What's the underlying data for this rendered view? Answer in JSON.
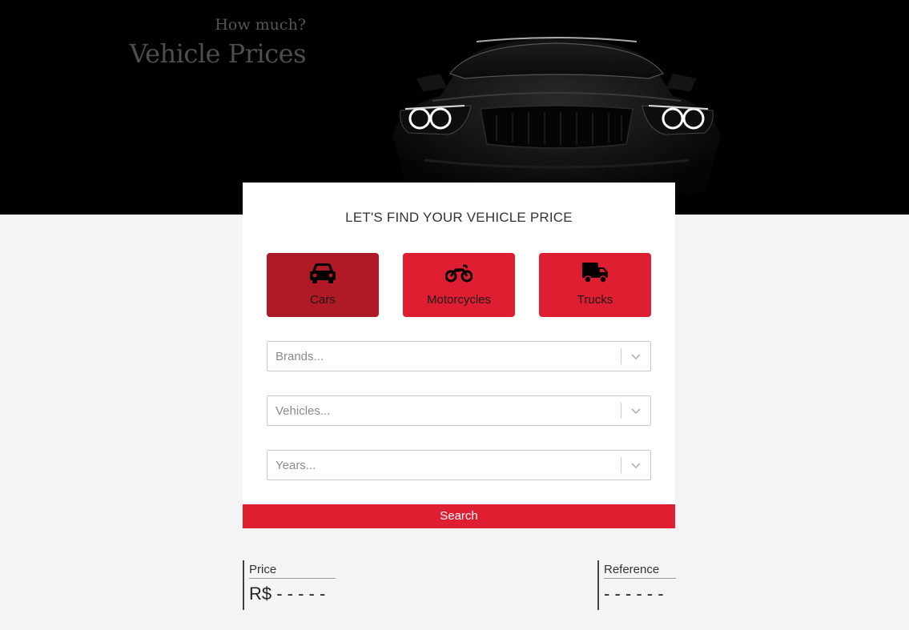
{
  "hero": {
    "subtitle": "How much?",
    "title": "Vehicle Prices"
  },
  "finder": {
    "title": "LET'S FIND YOUR VEHICLE PRICE",
    "types": [
      {
        "label": "Cars",
        "icon": "car-icon",
        "active": true
      },
      {
        "label": "Motorcycles",
        "icon": "motorcycle-icon",
        "active": false
      },
      {
        "label": "Trucks",
        "icon": "truck-icon",
        "active": false
      }
    ],
    "brands_placeholder": "Brands...",
    "vehicles_placeholder": "Vehicles...",
    "years_placeholder": "Years...",
    "search_label": "Search"
  },
  "result": {
    "price_label": "Price",
    "price_value": "R$ - - - - -",
    "reference_label": "Reference",
    "reference_value": "- - - - - -"
  },
  "colors": {
    "accent": "#e01e32",
    "accent_active": "#b01a26",
    "hero_bg": "#000000",
    "page_bg": "#f4f4f4"
  }
}
